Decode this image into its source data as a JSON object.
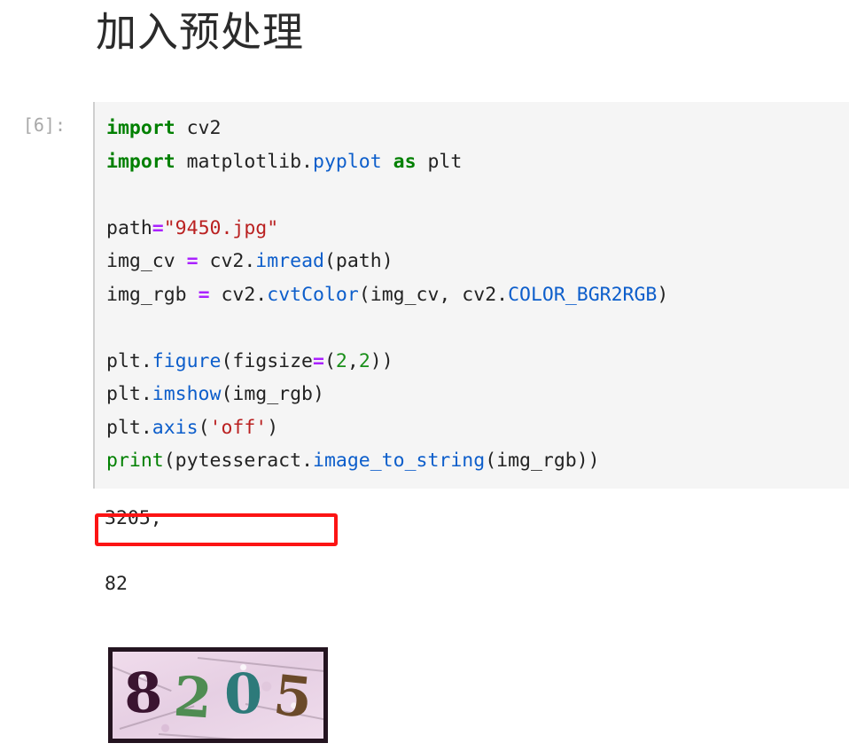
{
  "notebook": {
    "heading": "加入预处理",
    "cell": {
      "prompt_label": "[6]:",
      "execution_count": 6,
      "background_color": "#f5f5f5",
      "code_lines": [
        {
          "tokens": [
            {
              "t": "import",
              "k": "kw"
            },
            {
              "t": " cv2",
              "k": "plain"
            }
          ]
        },
        {
          "tokens": [
            {
              "t": "import",
              "k": "kw"
            },
            {
              "t": " matplotlib.",
              "k": "plain"
            },
            {
              "t": "pyplot",
              "k": "fn"
            },
            {
              "t": " ",
              "k": "plain"
            },
            {
              "t": "as",
              "k": "kw"
            },
            {
              "t": " plt",
              "k": "plain"
            }
          ]
        },
        {
          "tokens": []
        },
        {
          "tokens": [
            {
              "t": "path",
              "k": "plain"
            },
            {
              "t": "=",
              "k": "op"
            },
            {
              "t": "\"9450.jpg\"",
              "k": "str"
            }
          ]
        },
        {
          "tokens": [
            {
              "t": "img_cv ",
              "k": "plain"
            },
            {
              "t": "=",
              "k": "op"
            },
            {
              "t": " cv2.",
              "k": "plain"
            },
            {
              "t": "imread",
              "k": "fn"
            },
            {
              "t": "(path)",
              "k": "plain"
            }
          ]
        },
        {
          "tokens": [
            {
              "t": "img_rgb ",
              "k": "plain"
            },
            {
              "t": "=",
              "k": "op"
            },
            {
              "t": " cv2.",
              "k": "plain"
            },
            {
              "t": "cvtColor",
              "k": "fn"
            },
            {
              "t": "(img_cv, cv2.",
              "k": "plain"
            },
            {
              "t": "COLOR_BGR2RGB",
              "k": "fn"
            },
            {
              "t": ")",
              "k": "plain"
            }
          ]
        },
        {
          "tokens": []
        },
        {
          "tokens": [
            {
              "t": "plt.",
              "k": "plain"
            },
            {
              "t": "figure",
              "k": "fn"
            },
            {
              "t": "(figsize",
              "k": "plain"
            },
            {
              "t": "=",
              "k": "op"
            },
            {
              "t": "(",
              "k": "plain"
            },
            {
              "t": "2",
              "k": "num"
            },
            {
              "t": ",",
              "k": "plain"
            },
            {
              "t": "2",
              "k": "num"
            },
            {
              "t": "))",
              "k": "plain"
            }
          ]
        },
        {
          "tokens": [
            {
              "t": "plt.",
              "k": "plain"
            },
            {
              "t": "imshow",
              "k": "fn"
            },
            {
              "t": "(img_rgb)",
              "k": "plain"
            }
          ]
        },
        {
          "highlighted": true,
          "tokens": [
            {
              "t": "plt.",
              "k": "plain"
            },
            {
              "t": "axis",
              "k": "fn"
            },
            {
              "t": "(",
              "k": "plain"
            },
            {
              "t": "'off'",
              "k": "str"
            },
            {
              "t": ")",
              "k": "plain"
            }
          ]
        },
        {
          "tokens": [
            {
              "t": "print",
              "k": "builtin"
            },
            {
              "t": "(pytesseract.",
              "k": "plain"
            },
            {
              "t": "image_to_string",
              "k": "fn"
            },
            {
              "t": "(img_rgb))",
              "k": "plain"
            }
          ]
        }
      ],
      "code_plain_text": "import cv2\nimport matplotlib.pyplot as plt\n\npath=\"9450.jpg\"\nimg_cv = cv2.imread(path)\nimg_rgb = cv2.cvtColor(img_cv, cv2.COLOR_BGR2RGB)\n\nplt.figure(figsize=(2,2))\nplt.imshow(img_rgb)\nplt.axis('off')\nprint(pytesseract.image_to_string(img_rgb))"
    },
    "annotation": {
      "shape": "rectangle",
      "color": "#fc1414",
      "target_line": "plt.axis('off')",
      "border_width_px": 4
    },
    "output_stream": {
      "lines": [
        "3205,",
        "",
        "82"
      ]
    },
    "output_image": {
      "alt": "captcha-image",
      "characters": [
        "8",
        "2",
        "0",
        "5"
      ],
      "recognized_text": "8205",
      "char_colors": [
        "#3a1430",
        "#4f8c52",
        "#2d7a7a",
        "#6b4a2a"
      ],
      "background_color": "#ecd9e8",
      "border_color": "#241420"
    }
  }
}
